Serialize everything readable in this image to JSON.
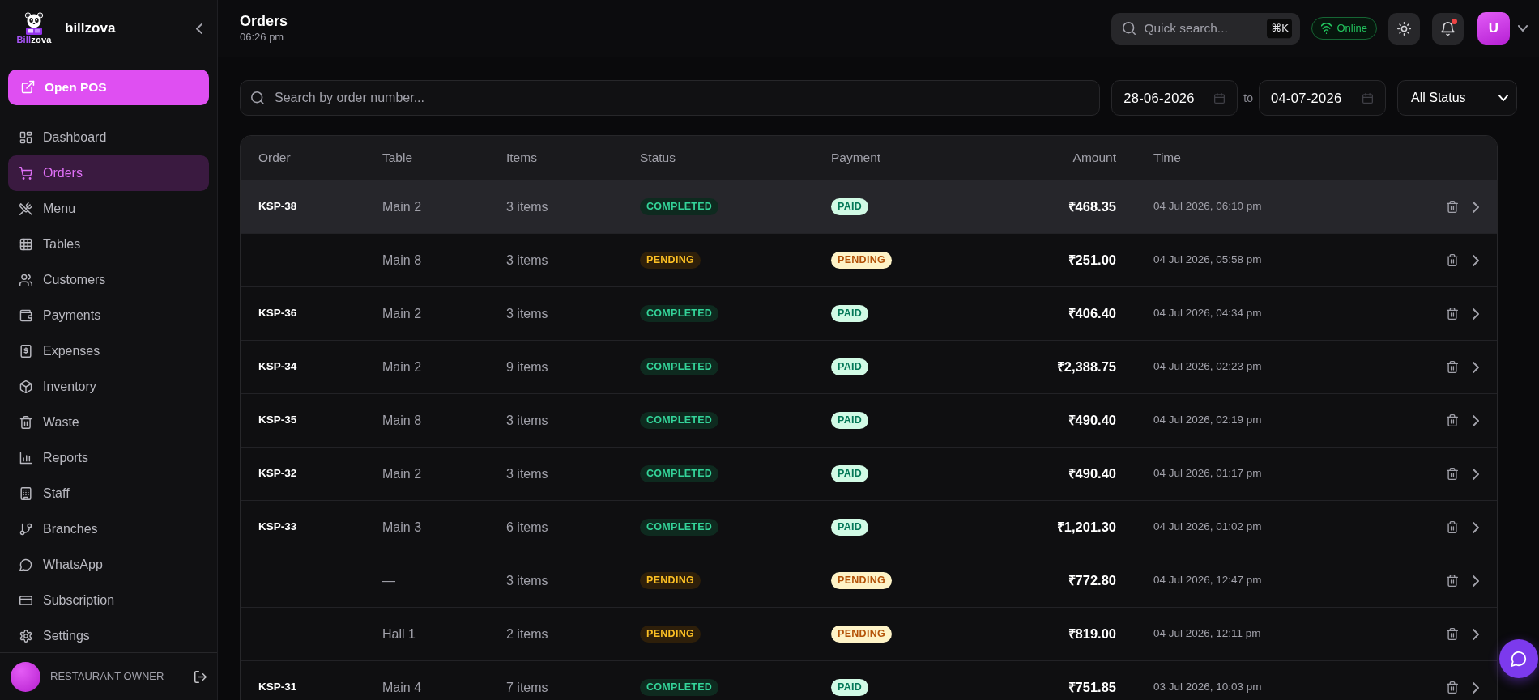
{
  "sidebar": {
    "logo": {
      "lead": "Bill",
      "rest": "zova"
    },
    "brand": "billzova",
    "pos_button": "Open POS",
    "items": [
      {
        "label": "Dashboard",
        "selected": false
      },
      {
        "label": "Orders",
        "selected": true
      },
      {
        "label": "Menu",
        "selected": false
      },
      {
        "label": "Tables",
        "selected": false
      },
      {
        "label": "Customers",
        "selected": false
      },
      {
        "label": "Payments",
        "selected": false
      },
      {
        "label": "Expenses",
        "selected": false
      },
      {
        "label": "Inventory",
        "selected": false
      },
      {
        "label": "Waste",
        "selected": false
      },
      {
        "label": "Reports",
        "selected": false
      },
      {
        "label": "Staff",
        "selected": false
      },
      {
        "label": "Branches",
        "selected": false
      },
      {
        "label": "WhatsApp",
        "selected": false
      },
      {
        "label": "Subscription",
        "selected": false
      },
      {
        "label": "Settings",
        "selected": false
      }
    ],
    "user_role": "RESTAURANT OWNER"
  },
  "header": {
    "title": "Orders",
    "time": "06:26 pm",
    "quick_search": {
      "placeholder": "Quick search...",
      "shortcut": "⌘K"
    },
    "connection": {
      "label": "Online",
      "kind": "online"
    },
    "notifications": {
      "unread": true
    },
    "avatar": "U"
  },
  "filters": {
    "search": {
      "placeholder": "Search by order number..."
    },
    "date_from": "28-06-2026",
    "separator": "to",
    "date_to": "04-07-2026",
    "status": "All Status"
  },
  "table": {
    "columns": [
      "Order",
      "Table",
      "Items",
      "Status",
      "Payment",
      "Amount",
      "Time"
    ],
    "rows": [
      {
        "order": "KSP-38",
        "table": "Main 2",
        "items": "3 items",
        "status": {
          "label": "COMPLETED",
          "kind": "completed"
        },
        "payment": {
          "label": "PAID",
          "kind": "paid"
        },
        "amount": "₹468.35",
        "time": "04 Jul 2026, 06:10 pm",
        "highlighted": true
      },
      {
        "table": "Main 8",
        "items": "3 items",
        "status": {
          "label": "PENDING",
          "kind": "pending"
        },
        "payment": {
          "label": "PENDING",
          "kind": "pending"
        },
        "amount": "₹251.00",
        "time": "04 Jul 2026, 05:58 pm",
        "highlighted": false
      },
      {
        "order": "KSP-36",
        "table": "Main 2",
        "items": "3 items",
        "status": {
          "label": "COMPLETED",
          "kind": "completed"
        },
        "payment": {
          "label": "PAID",
          "kind": "paid"
        },
        "amount": "₹406.40",
        "time": "04 Jul 2026, 04:34 pm",
        "highlighted": false
      },
      {
        "order": "KSP-34",
        "table": "Main 2",
        "items": "9 items",
        "status": {
          "label": "COMPLETED",
          "kind": "completed"
        },
        "payment": {
          "label": "PAID",
          "kind": "paid"
        },
        "amount": "₹2,388.75",
        "time": "04 Jul 2026, 02:23 pm",
        "highlighted": false
      },
      {
        "order": "KSP-35",
        "table": "Main 8",
        "items": "3 items",
        "status": {
          "label": "COMPLETED",
          "kind": "completed"
        },
        "payment": {
          "label": "PAID",
          "kind": "paid"
        },
        "amount": "₹490.40",
        "time": "04 Jul 2026, 02:19 pm",
        "highlighted": false
      },
      {
        "order": "KSP-32",
        "table": "Main 2",
        "items": "3 items",
        "status": {
          "label": "COMPLETED",
          "kind": "completed"
        },
        "payment": {
          "label": "PAID",
          "kind": "paid"
        },
        "amount": "₹490.40",
        "time": "04 Jul 2026, 01:17 pm",
        "highlighted": false
      },
      {
        "order": "KSP-33",
        "table": "Main 3",
        "items": "6 items",
        "status": {
          "label": "COMPLETED",
          "kind": "completed"
        },
        "payment": {
          "label": "PAID",
          "kind": "paid"
        },
        "amount": "₹1,201.30",
        "time": "04 Jul 2026, 01:02 pm",
        "highlighted": false
      },
      {
        "table": "—",
        "items": "3 items",
        "status": {
          "label": "PENDING",
          "kind": "pending"
        },
        "payment": {
          "label": "PENDING",
          "kind": "pending"
        },
        "amount": "₹772.80",
        "time": "04 Jul 2026, 12:47 pm",
        "highlighted": false
      },
      {
        "table": "Hall 1",
        "items": "2 items",
        "status": {
          "label": "PENDING",
          "kind": "pending"
        },
        "payment": {
          "label": "PENDING",
          "kind": "pending"
        },
        "amount": "₹819.00",
        "time": "04 Jul 2026, 12:11 pm",
        "highlighted": false
      },
      {
        "order": "KSP-31",
        "table": "Main 4",
        "items": "7 items",
        "status": {
          "label": "COMPLETED",
          "kind": "completed"
        },
        "payment": {
          "label": "PAID",
          "kind": "paid"
        },
        "amount": "₹751.85",
        "time": "03 Jul 2026, 10:03 pm",
        "highlighted": false
      }
    ]
  }
}
